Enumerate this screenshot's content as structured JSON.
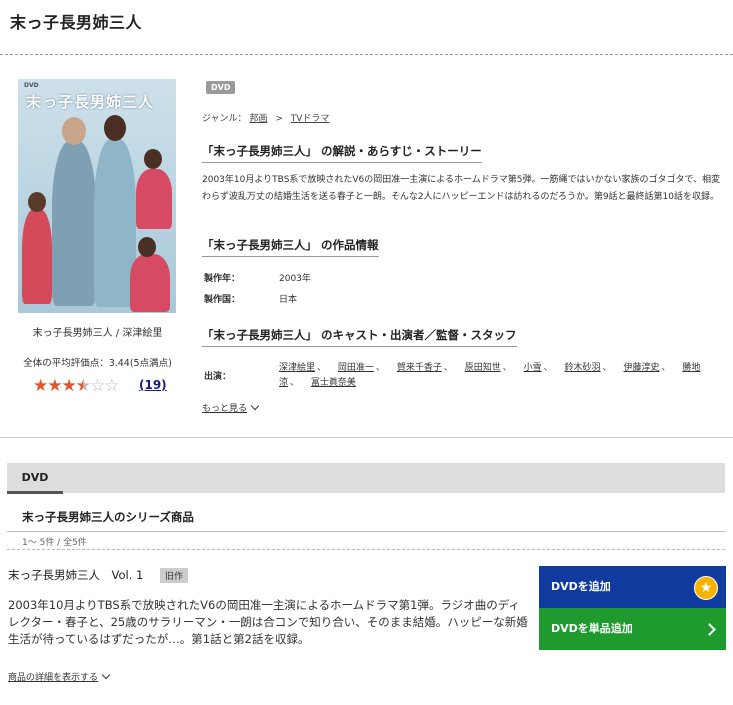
{
  "page_title": "末っ子長男姉三人",
  "cover": {
    "label_dvd": "DVD",
    "title_text": "末っ子長男姉三人",
    "caption": "末っ子長男姉三人 / 深津絵里"
  },
  "rating": {
    "label": "全体の平均評価点：3.44(5点満点)",
    "score": 3.44,
    "max": 5,
    "review_count": "(19)"
  },
  "format_tag": "DVD",
  "genre": {
    "label": "ジャンル：",
    "items": [
      "邦画",
      "TVドラマ"
    ],
    "separator": ">"
  },
  "synopsis": {
    "heading": "「末っ子長男姉三人」 の解説・あらすじ・ストーリー",
    "text": "2003年10月よりTBS系で放映されたV6の岡田准一主演によるホームドラマ第5弾。一筋縄ではいかない家族のゴタゴタで、相変わらず波乱万丈の結婚生活を送る春子と一朗。そんな2人にハッピーエンドは訪れるのだろうか。第9話と最終話第10話を収録。"
  },
  "work_info": {
    "heading": "「末っ子長男姉三人」 の作品情報",
    "year_label": "製作年：",
    "year_value": "2003年",
    "country_label": "製作国：",
    "country_value": "日本"
  },
  "cast": {
    "heading": "「末っ子長男姉三人」 のキャスト・出演者／監督・スタッフ",
    "label": "出演：",
    "names": [
      "深津絵里",
      "岡田准一",
      "賀来千香子",
      "原田知世",
      "小雪",
      "鈴木砂羽",
      "伊藤淳史",
      "勝地涼",
      "冨士眞奈美"
    ],
    "more": "もっと見る"
  },
  "tabs": [
    "DVD"
  ],
  "series": {
    "title": "末っ子長男姉三人のシリーズ商品",
    "count": "1～ 5件 / 全5件"
  },
  "item": {
    "title": "末っ子長男姉三人　Vol. 1",
    "tag": "旧作",
    "description": "2003年10月よりTBS系で放映されたV6の岡田准一主演によるホームドラマ第1弾。ラジオ曲のディレクター・春子と、25歳のサラリーマン・一朗は合コンで知り合い、そのまま結婚。ハッピーな新婚生活が待っているはずだったが…。第1話と第2話を収録。",
    "detail_link": "商品の詳細を表示する",
    "btn_add": "DVDを追加",
    "btn_single": "DVDを単品追加"
  },
  "colors": {
    "btn_add": "#0f3a9e",
    "btn_single": "#1e9a2e",
    "star": "#e2552a"
  }
}
